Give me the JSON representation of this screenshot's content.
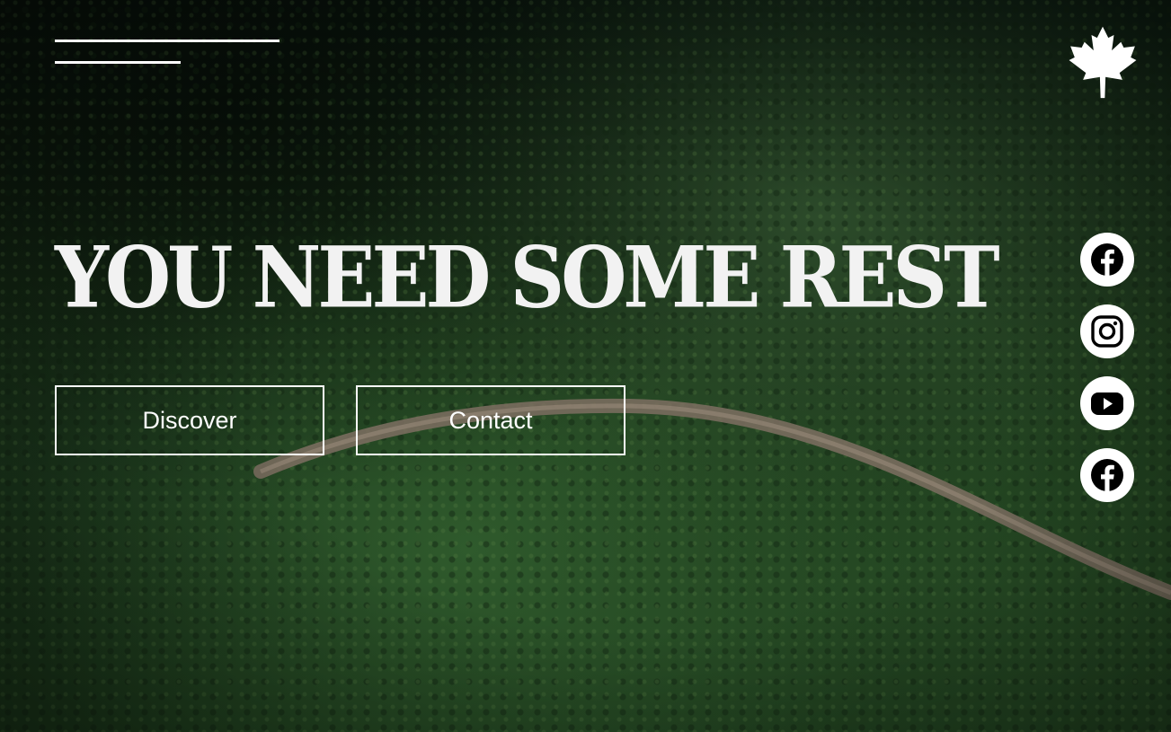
{
  "menu": {
    "icon": "hamburger-menu-icon"
  },
  "logo": {
    "icon": "maple-leaf-icon"
  },
  "hero": {
    "headline": "YOU NEED SOME REST"
  },
  "buttons": {
    "discover": "Discover",
    "contact": "Contact"
  },
  "social": [
    {
      "icon": "facebook-icon"
    },
    {
      "icon": "instagram-icon"
    },
    {
      "icon": "youtube-icon"
    },
    {
      "icon": "facebook-icon"
    }
  ],
  "colors": {
    "text": "#ffffff",
    "headline": "#f2f2f2",
    "forest": "#1d3b1c",
    "road": "#8a7a6a"
  }
}
